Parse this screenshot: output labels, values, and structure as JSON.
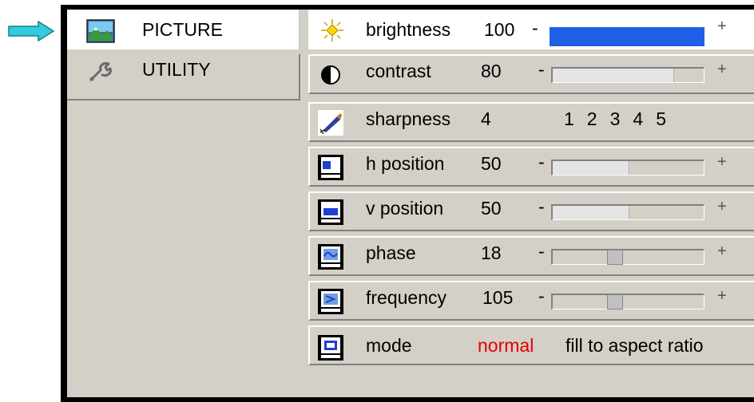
{
  "menu": {
    "tabs": [
      {
        "label": "PICTURE",
        "icon": "picture-icon",
        "active": true
      },
      {
        "label": "UTILITY",
        "icon": "wrench-icon",
        "active": false
      }
    ]
  },
  "settings": {
    "brightness": {
      "label": "brightness",
      "value": "100",
      "minus": "-",
      "plus": "+",
      "level": 1.0
    },
    "contrast": {
      "label": "contrast",
      "value": "80",
      "minus": "-",
      "plus": "+",
      "level": 0.8
    },
    "sharpness": {
      "label": "sharpness",
      "value": "4",
      "levels": [
        "1",
        "2",
        "3",
        "4",
        "5"
      ]
    },
    "h_position": {
      "label": "h position",
      "value": "50",
      "minus": "-",
      "plus": "+",
      "level": 0.5
    },
    "v_position": {
      "label": "v position",
      "value": "50",
      "minus": "-",
      "plus": "+",
      "level": 0.5
    },
    "phase": {
      "label": "phase",
      "value": "18",
      "minus": "-",
      "plus": "+",
      "level": 0.4
    },
    "frequency": {
      "label": "frequency",
      "value": "105",
      "minus": "-",
      "plus": "+",
      "level": 0.4
    },
    "mode": {
      "label": "mode",
      "current": "normal",
      "alternative": "fill to aspect ratio"
    }
  },
  "colors": {
    "pointer_arrow": "#33ccdd",
    "brightness_bar": "#1f5fe6",
    "mode_selected": "#e00000",
    "osd_background": "#d4d0c8"
  }
}
